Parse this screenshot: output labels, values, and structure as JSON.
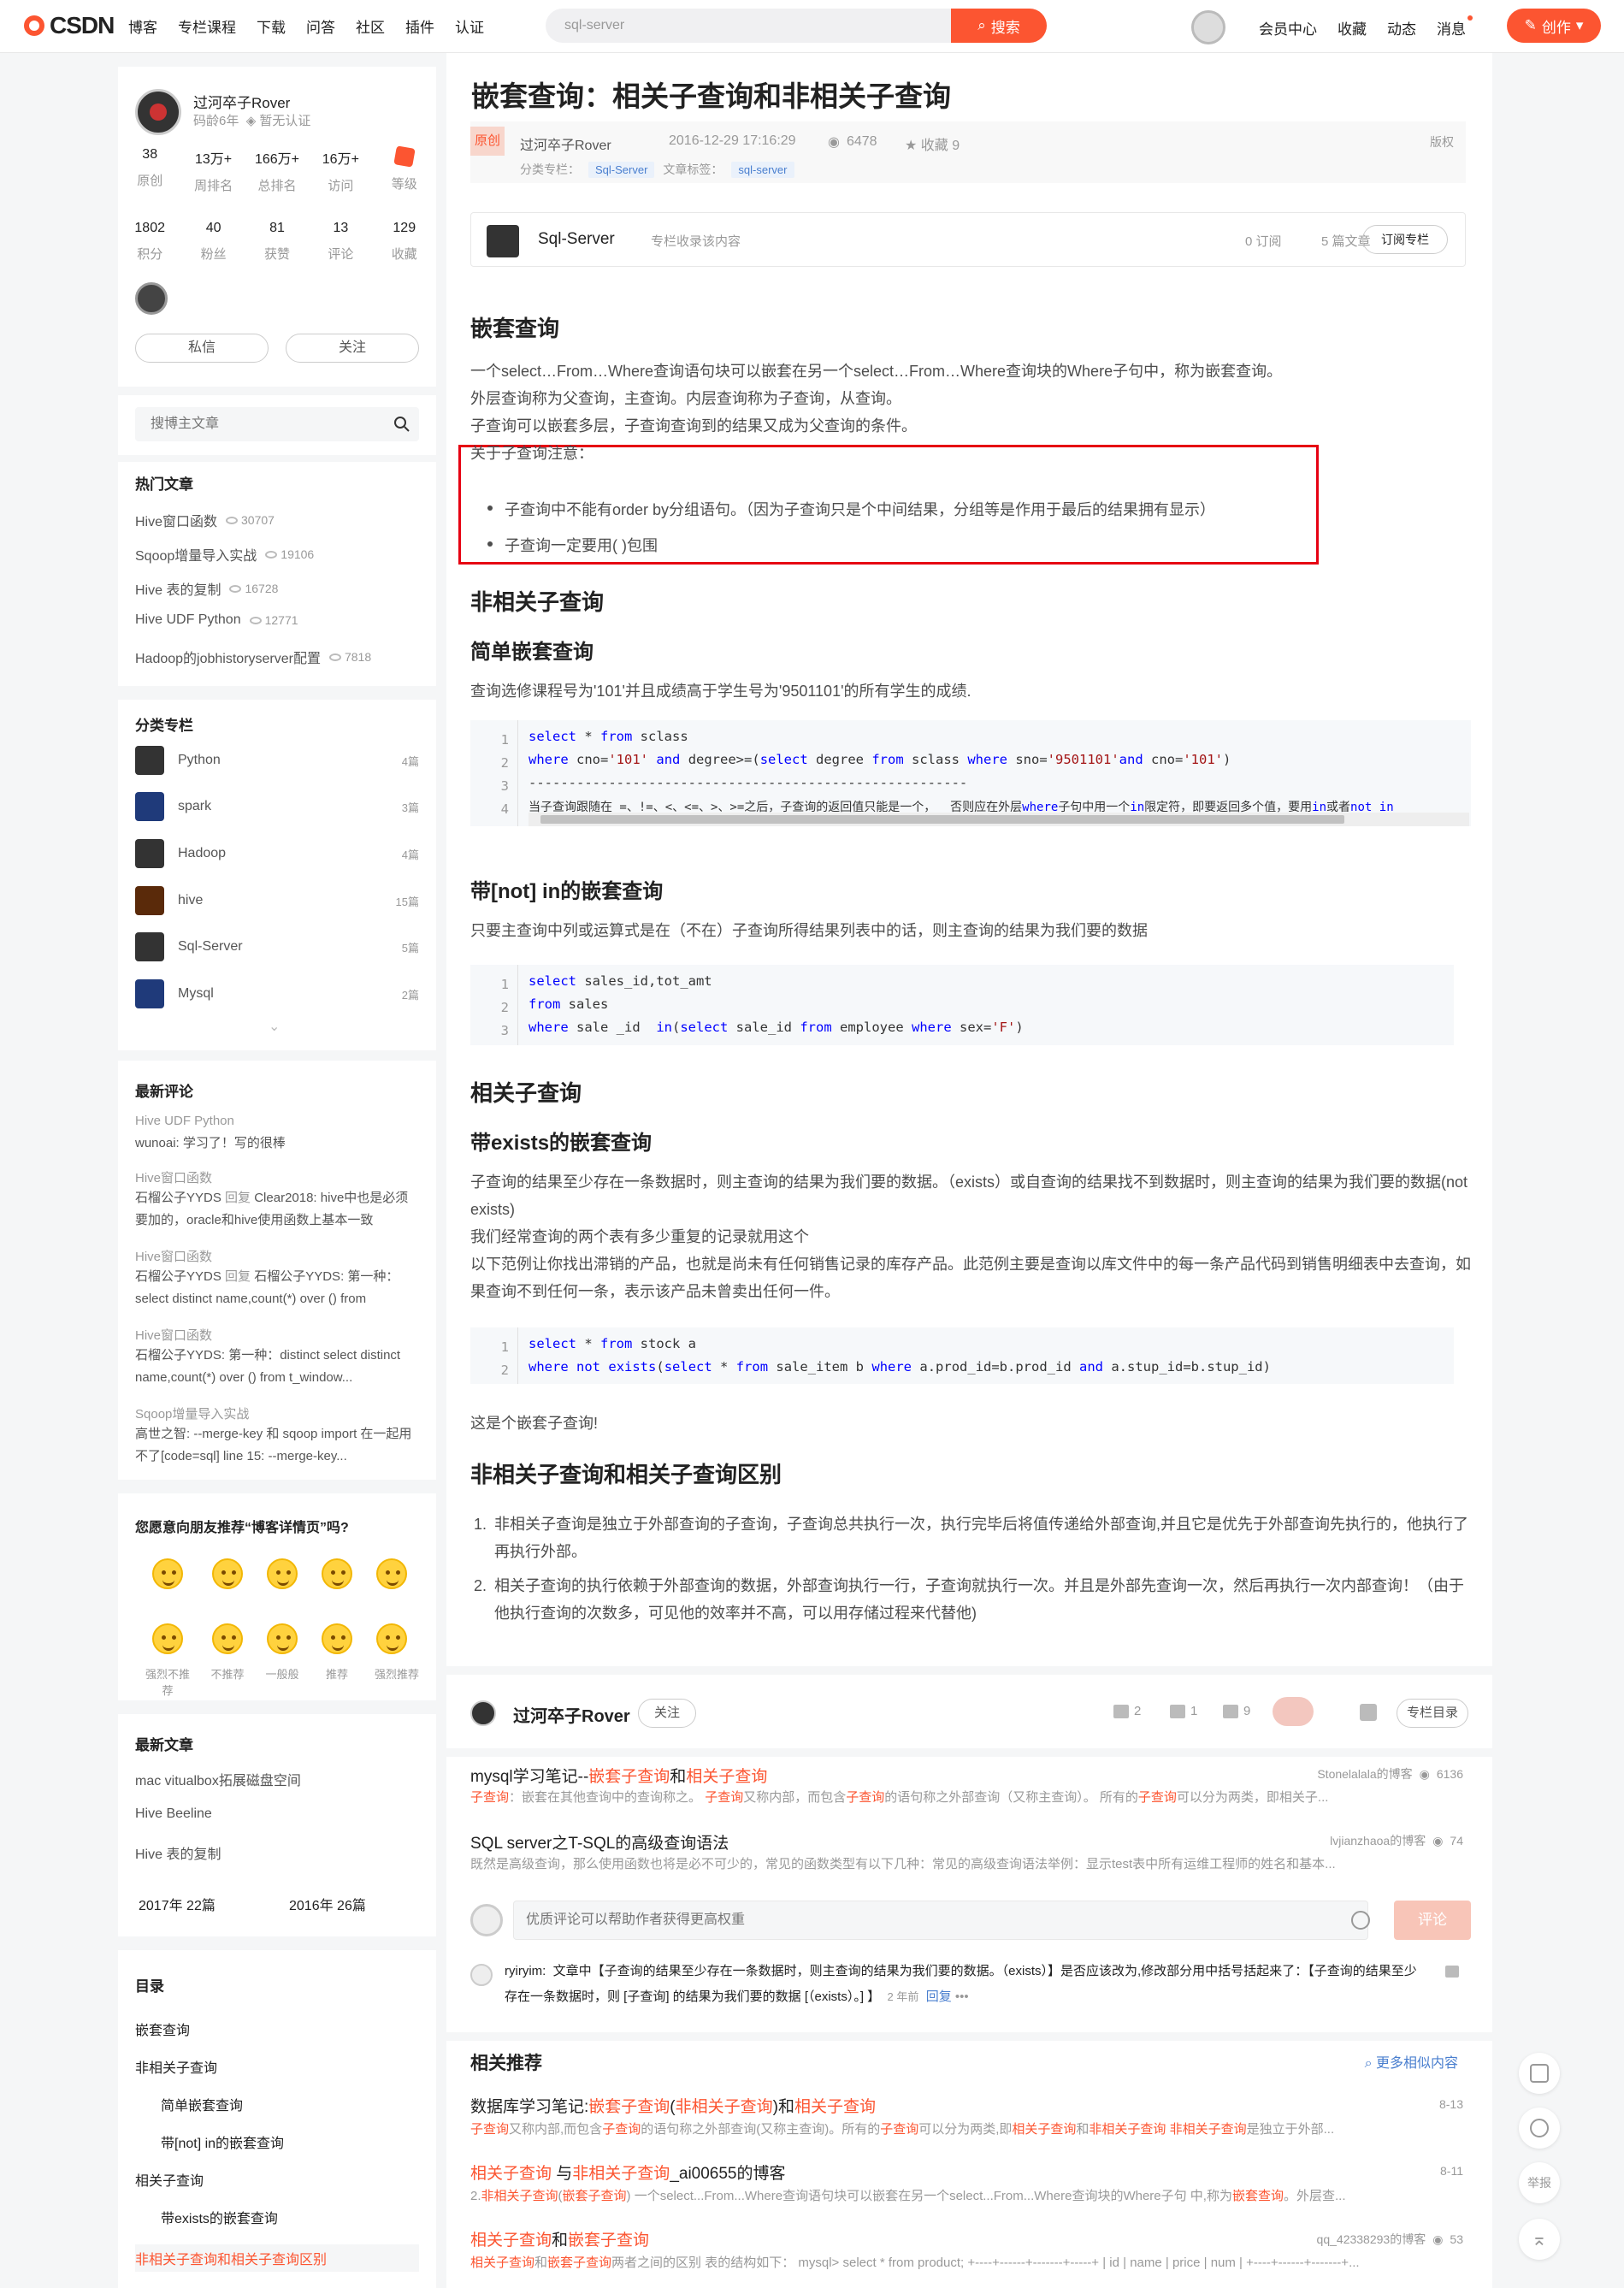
{
  "topbar": {
    "logo": "CSDN",
    "nav": [
      "博客",
      "专栏课程",
      "下载",
      "问答",
      "社区",
      "插件",
      "认证"
    ],
    "search_value": "sql-server",
    "search_btn": "搜索",
    "right": [
      "会员中心",
      "收藏",
      "动态",
      "消息"
    ],
    "create": "创作"
  },
  "profile": {
    "name": "过河卒子Rover",
    "age": "码龄6年",
    "cert": "暂无认证",
    "stats1": [
      {
        "num": "38",
        "lbl": "原创"
      },
      {
        "num": "13万+",
        "lbl": "周排名"
      },
      {
        "num": "166万+",
        "lbl": "总排名"
      },
      {
        "num": "16万+",
        "lbl": "访问"
      },
      {
        "num": "",
        "lbl": "等级"
      }
    ],
    "stats2": [
      {
        "num": "1802",
        "lbl": "积分"
      },
      {
        "num": "40",
        "lbl": "粉丝"
      },
      {
        "num": "81",
        "lbl": "获赞"
      },
      {
        "num": "13",
        "lbl": "评论"
      },
      {
        "num": "129",
        "lbl": "收藏"
      }
    ],
    "msg_btn": "私信",
    "follow_btn": "关注"
  },
  "blog_search": {
    "placeholder": "搜博主文章"
  },
  "hot": {
    "title": "热门文章",
    "items": [
      {
        "t": "Hive窗口函数",
        "v": "30707"
      },
      {
        "t": "Sqoop增量导入实战",
        "v": "19106"
      },
      {
        "t": "Hive 表的复制",
        "v": "16728"
      },
      {
        "t": "Hive UDF Python",
        "v": "12771"
      },
      {
        "t": "Hadoop的jobhistoryserver配置",
        "v": "7818"
      }
    ]
  },
  "columns": {
    "title": "分类专栏",
    "items": [
      {
        "t": "Python",
        "c": "4篇"
      },
      {
        "t": "spark",
        "c": "3篇"
      },
      {
        "t": "Hadoop",
        "c": "4篇"
      },
      {
        "t": "hive",
        "c": "15篇"
      },
      {
        "t": "Sql-Server",
        "c": "5篇"
      },
      {
        "t": "Mysql",
        "c": "2篇"
      }
    ]
  },
  "comments": {
    "title": "最新评论",
    "items": [
      {
        "src": "Hive UDF Python",
        "user": "wunoai:",
        "txt": "学习了！写的很棒",
        "rep": ""
      },
      {
        "src": "Hive窗口函数",
        "user": "石榴公子YYDS",
        "rep": "回复",
        "txt": "Clear2018: hive中也是必须要加的，oracle和hive使用函数上基本一致"
      },
      {
        "src": "Hive窗口函数",
        "user": "石榴公子YYDS",
        "rep": "回复",
        "txt": "石榴公子YYDS: 第一种：select distinct name,count(*) over () from t_window"
      },
      {
        "src": "Hive窗口函数",
        "user": "石榴公子YYDS:",
        "rep": "",
        "txt": "第一种：distinct select distinct name,count(*) over () from t_window..."
      },
      {
        "src": "Sqoop增量导入实战",
        "user": "高世之智:",
        "rep": "",
        "txt": "--merge-key 和 sqoop import 在一起用不了[code=sql] line 15: --merge-key..."
      }
    ]
  },
  "recommend": {
    "title": "您愿意向朋友推荐“博客详情页”吗?",
    "labels": [
      "强烈不推荐",
      "不推荐",
      "一般般",
      "推荐",
      "强烈推荐"
    ]
  },
  "latest": {
    "title": "最新文章",
    "items": [
      "mac vitualbox拓展磁盘空间",
      "Hive Beeline",
      "Hive 表的复制"
    ],
    "years": [
      "2017年  22篇",
      "2016年  26篇"
    ]
  },
  "toc": {
    "title": "目录",
    "items": [
      {
        "t": "嵌套查询",
        "lvl": 1
      },
      {
        "t": "非相关子查询",
        "lvl": 1
      },
      {
        "t": "简单嵌套查询",
        "lvl": 2
      },
      {
        "t": "带[not] in的嵌套查询",
        "lvl": 2
      },
      {
        "t": "相关子查询",
        "lvl": 1
      },
      {
        "t": "带exists的嵌套查询",
        "lvl": 2
      },
      {
        "t": "非相关子查询和相关子查询区别",
        "lvl": 1
      }
    ]
  },
  "article": {
    "title": "嵌套查询：相关子查询和非相关子查询",
    "original": "原创",
    "author": "过河卒子Rover",
    "date": "2016-12-29 17:16:29",
    "views": "6478",
    "favs": "收藏 9",
    "copyright": "版权",
    "cat_label": "分类专栏：",
    "cat_tag": "Sql-Server",
    "art_label": "文章标签：",
    "art_tag": "sql-server",
    "col_name": "Sql-Server",
    "col_tip": "专栏收录该内容",
    "col_subs": "0 订阅",
    "col_count": "5 篇文章",
    "col_btn": "订阅专栏",
    "h_nested": "嵌套查询",
    "p1": "一个select…From…Where查询语句块可以嵌套在另一个select…From…Where查询块的Where子句中，称为嵌套查询。",
    "p2": "外层查询称为父查询，主查询。内层查询称为子查询，从查询。",
    "p3": "子查询可以嵌套多层，子查询查询到的结果又成为父查询的条件。",
    "note": "关于子查询注意：",
    "b1": "子查询中不能有order by分组语句。（因为子查询只是个中间结果，分组等是作用于最后的结果拥有显示）",
    "b2": "子查询一定要用( )包围",
    "h_noncor": "非相关子查询",
    "h_simple": "简单嵌套查询",
    "p_simple": "查询选修课程号为'101'并且成绩高于学生号为'9501101'的所有学生的成绩.",
    "h_notin": "带[not] in的嵌套查询",
    "p_notin": "只要主查询中列或运算式是在（不在）子查询所得结果列表中的话，则主查询的结果为我们要的数据",
    "h_cor": "相关子查询",
    "h_exists": "带exists的嵌套查询",
    "p_ex1": "子查询的结果至少存在一条数据时，则主查询的结果为我们要的数据。（exists）或自查询的结果找不到数据时，则主查询的结果为我们要的数据(not exists)",
    "p_ex2": "我们经常查询的两个表有多少重复的记录就用这个",
    "p_ex3": "以下范例让你找出滞销的产品，也就是尚未有任何销售记录的库存产品。此范例主要是查询以库文件中的每一条产品代码到销售明细表中去查询，如果查询不到任何一条，表示该产品未曾卖出任何一件。",
    "p_nested_end": "这是个嵌套子查询!",
    "h_diff": "非相关子查询和相关子查询区别",
    "ol1": "非相关子查询是独立于外部查询的子查询，子查询总共执行一次，执行完毕后将值传递给外部查询,并且它是优先于外部查询先执行的，他执行了再执行外部。",
    "ol2": "相关子查询的执行依赖于外部查询的数据，外部查询执行一行，子查询就执行一次。并且是外部先查询一次，然后再执行一次内部查询！（由于他执行查询的次数多，可见他的效率并不高，可以用存储过程来代替他)"
  },
  "code1": {
    "lines": [
      "select * from sclass",
      "where cno='101' and degree>=(select degree from sclass where sno='9501101'and cno='101')",
      "-------------------------------------------------------",
      "当子查询跟随在 =、!=、<、<=、>、>=之后，子查询的返回值只能是一个，  否则应在外层where子句中用一个in限定符，即要返回多个值，要用in或者not in"
    ]
  },
  "code2": {
    "lines": [
      "select sales_id,tot_amt",
      "from sales",
      "where sale _id  in(select sale_id from employee where sex='F')"
    ]
  },
  "code3": {
    "lines": [
      "select * from stock a",
      "where not exists(select * from sale_item b where a.prod_id=b.prod_id and a.stup_id=b.stup_id)"
    ]
  },
  "authorbar": {
    "name": "过河卒子Rover",
    "follow": "关注",
    "likes": "2",
    "comments": "1",
    "favs": "9",
    "dir": "专栏目录"
  },
  "related": [
    {
      "t": "mysql学习笔记--嵌套子查询和相关子查询",
      "src": "Stonelalala的博客",
      "v": "6136",
      "d": "子查询：嵌套在其他查询中的查询称之。 子查询又称内部，而包含子查询的语句称之外部查询（又称主查询）。 所有的子查询可以分为两类，即相关子..."
    },
    {
      "t": "SQL server之T-SQL的高级查询语法",
      "src": "lvjianzhaoa的博客",
      "v": "74",
      "d": "既然是高级查询，那么使用函数也将是必不可少的，常见的函数类型有以下几种：常见的高级查询语法举例：显示test表中所有运维工程师的姓名和基本..."
    }
  ],
  "comment_box": {
    "placeholder": "优质评论可以帮助作者获得更高权重",
    "btn": "评论"
  },
  "comment1": {
    "user": "ryiryim:",
    "txt": "文章中【子查询的结果至少存在一条数据时，则主查询的结果为我们要的数据。（exists）】是否应该改为,修改部分用中括号括起来了：【子查询的结果至少存在一条数据时，则 [子查询] 的结果为我们要的数据 [（exists）。] 】",
    "time": "2 年前",
    "reply": "回复"
  },
  "related2": {
    "title": "相关推荐",
    "more": "更多相似内容",
    "items": [
      {
        "t": "数据库学习笔记:嵌套子查询(非相关子查询)和相关子查询",
        "m": "8-13",
        "d": "子查询又称内部,而包含子查询的语句称之外部查询(又称主查询)。所有的子查询可以分为两类,即相关子查询和非相关子查询 非相关子查询是独立于外部..."
      },
      {
        "t": "相关子查询 与非相关子查询_ai00655的博客",
        "m": "8-11",
        "d": "2.非相关子查询(嵌套子查询) 一个select...From...Where查询语句块可以嵌套在另一个select...From...Where查询块的Where子句 中,称为嵌套查询。外层查..."
      },
      {
        "t": "相关子查询和嵌套子查询",
        "m": "qq_42338293的博客",
        "v": "53",
        "d": "相关子查询和嵌套子查询两者之间的区别 表的结构如下： mysql> select * from product; +----+------+-------+-----+ | id | name | price | num | +----+------+-------+..."
      }
    ]
  },
  "rightbar": {
    "report": "举报"
  },
  "colors": {
    "accent": "#fc5531",
    "link": "#4a7fcf",
    "box": "#e60012"
  }
}
